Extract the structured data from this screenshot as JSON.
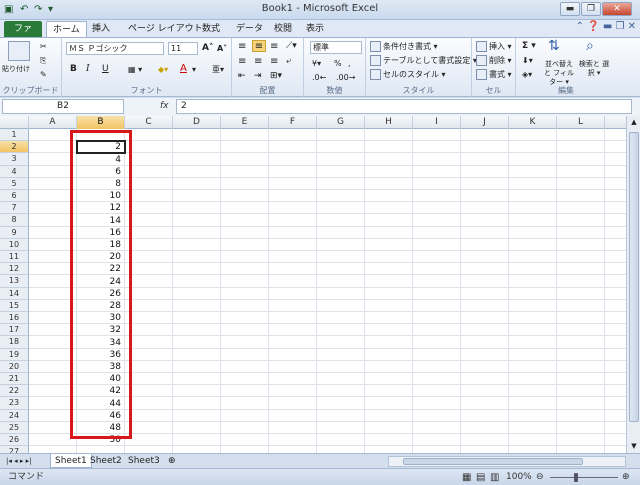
{
  "window": {
    "title": "Book1 - Microsoft Excel",
    "controls": [
      "▬",
      "❐",
      "✕"
    ]
  },
  "quick_access": [
    "▣",
    "↶",
    "↷",
    "▾"
  ],
  "tabs": [
    {
      "label": "ファイル",
      "file": true
    },
    {
      "label": "ホーム",
      "active": true
    },
    {
      "label": "挿入"
    },
    {
      "label": "ページ レイアウト"
    },
    {
      "label": "数式"
    },
    {
      "label": "データ"
    },
    {
      "label": "校閲"
    },
    {
      "label": "表示"
    }
  ],
  "ribbon": {
    "clipboard": {
      "paste_label": "貼り付け",
      "group_label": "クリップボード"
    },
    "font": {
      "font_name": "ＭＳ Ｐゴシック",
      "font_size": "11",
      "bold": "B",
      "italic": "I",
      "underline": "U",
      "group_label": "フォント"
    },
    "alignment": {
      "group_label": "配置"
    },
    "number": {
      "format": "標準",
      "percent": "%",
      "comma": ",",
      "group_label": "数値"
    },
    "styles": {
      "conditional": "条件付き書式 ▾",
      "as_table": "テーブルとして書式設定 ▾",
      "cell_styles": "セルのスタイル ▾",
      "group_label": "スタイル"
    },
    "cells": {
      "insert": "挿入 ▾",
      "delete": "削除 ▾",
      "format": "書式 ▾",
      "group_label": "セル"
    },
    "editing": {
      "sum": "Σ ▾",
      "sort_filter": "並べ替えと フィルター ▾",
      "find_select": "検索と 選択 ▾",
      "group_label": "編集"
    }
  },
  "formula_bar": {
    "name_box": "B2",
    "fx": "fx",
    "value": "2"
  },
  "columns": [
    "A",
    "B",
    "C",
    "D",
    "E",
    "F",
    "G",
    "H",
    "I",
    "J",
    "K",
    "L"
  ],
  "selected_column": "B",
  "rows": [
    "1",
    "2",
    "3",
    "4",
    "5",
    "6",
    "7",
    "8",
    "9",
    "10",
    "11",
    "12",
    "13",
    "14",
    "15",
    "16",
    "17",
    "18",
    "19",
    "20",
    "21",
    "22",
    "23",
    "24",
    "25",
    "26",
    "27"
  ],
  "selected_row": "2",
  "column_b_values": [
    "",
    "2",
    "4",
    "6",
    "8",
    "10",
    "12",
    "14",
    "16",
    "18",
    "20",
    "22",
    "24",
    "26",
    "28",
    "30",
    "32",
    "34",
    "36",
    "38",
    "40",
    "42",
    "44",
    "46",
    "48",
    "50",
    ""
  ],
  "sheets": [
    {
      "name": "Sheet1",
      "active": true
    },
    {
      "name": "Sheet2"
    },
    {
      "name": "Sheet3"
    }
  ],
  "status": {
    "mode": "コマンド",
    "zoom": "100%"
  },
  "colors": {
    "file_tab": "#2a7a3a",
    "highlight_box": "#d8171b",
    "selected_header": "#f2c363"
  }
}
